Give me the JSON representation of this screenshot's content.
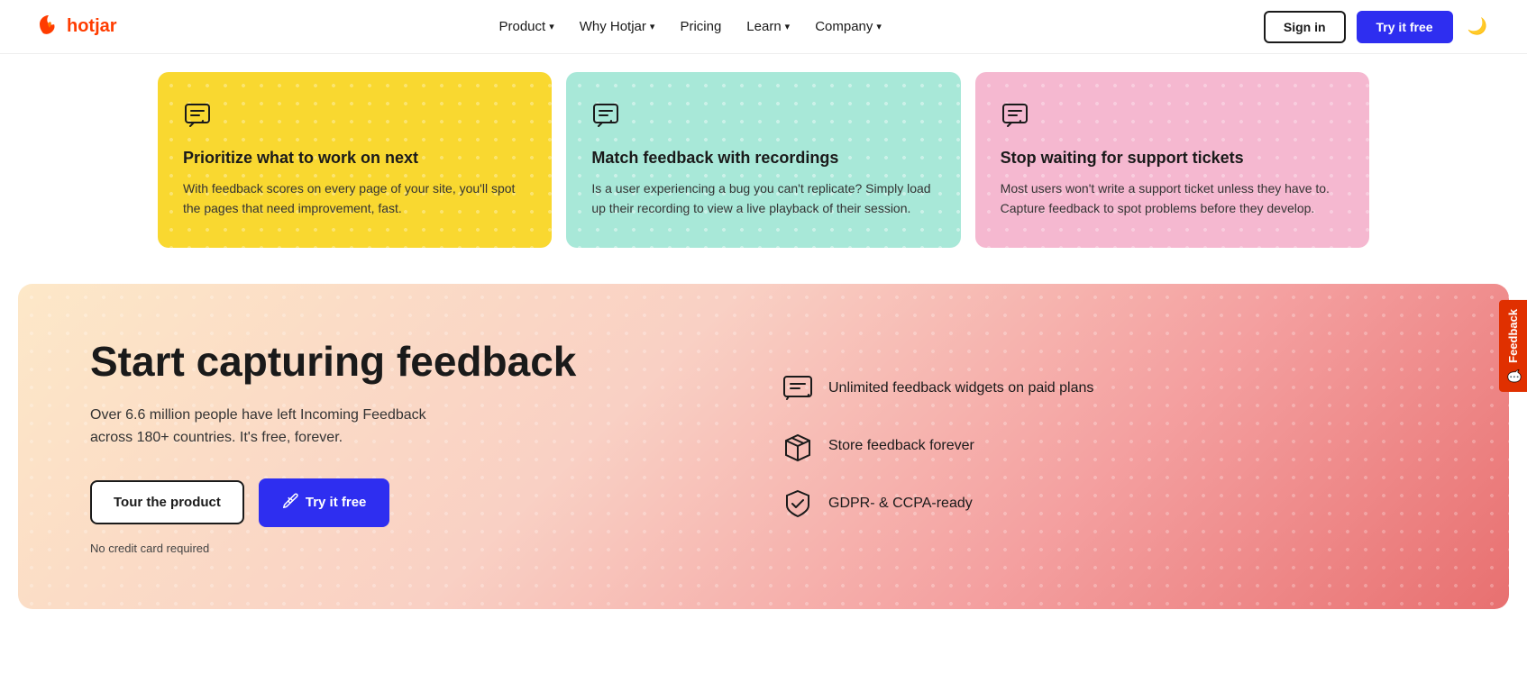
{
  "nav": {
    "logo_text": "hotjar",
    "links": [
      {
        "label": "Product",
        "has_dropdown": true
      },
      {
        "label": "Why Hotjar",
        "has_dropdown": true
      },
      {
        "label": "Pricing",
        "has_dropdown": false
      },
      {
        "label": "Learn",
        "has_dropdown": true
      },
      {
        "label": "Company",
        "has_dropdown": true
      }
    ],
    "sign_in_label": "Sign in",
    "try_free_label": "Try it free",
    "dark_mode_icon": "🌙"
  },
  "cards": [
    {
      "id": "yellow",
      "title": "Prioritize what to work on next",
      "desc": "With feedback scores on every page of your site, you'll spot the pages that need improvement, fast.",
      "theme": "yellow"
    },
    {
      "id": "teal",
      "title": "Match feedback with recordings",
      "desc": "Is a user experiencing a bug you can't replicate? Simply load up their recording to view a live playback of their session.",
      "theme": "teal"
    },
    {
      "id": "pink",
      "title": "Stop waiting for support tickets",
      "desc": "Most users won't write a support ticket unless they have to. Capture feedback to spot problems before they develop.",
      "theme": "pink"
    }
  ],
  "cta": {
    "title": "Start capturing feedback",
    "desc": "Over 6.6 million people have left Incoming Feedback across 180+ countries. It's free, forever.",
    "tour_label": "Tour the product",
    "try_label": "Try it free",
    "no_card_label": "No credit card required",
    "features": [
      {
        "text": "Unlimited feedback widgets on paid plans",
        "icon": "widget"
      },
      {
        "text": "Store feedback forever",
        "icon": "box"
      },
      {
        "text": "GDPR- & CCPA-ready",
        "icon": "shield"
      }
    ]
  },
  "feedback_tab": {
    "label": "Feedback",
    "icon": "💬"
  }
}
